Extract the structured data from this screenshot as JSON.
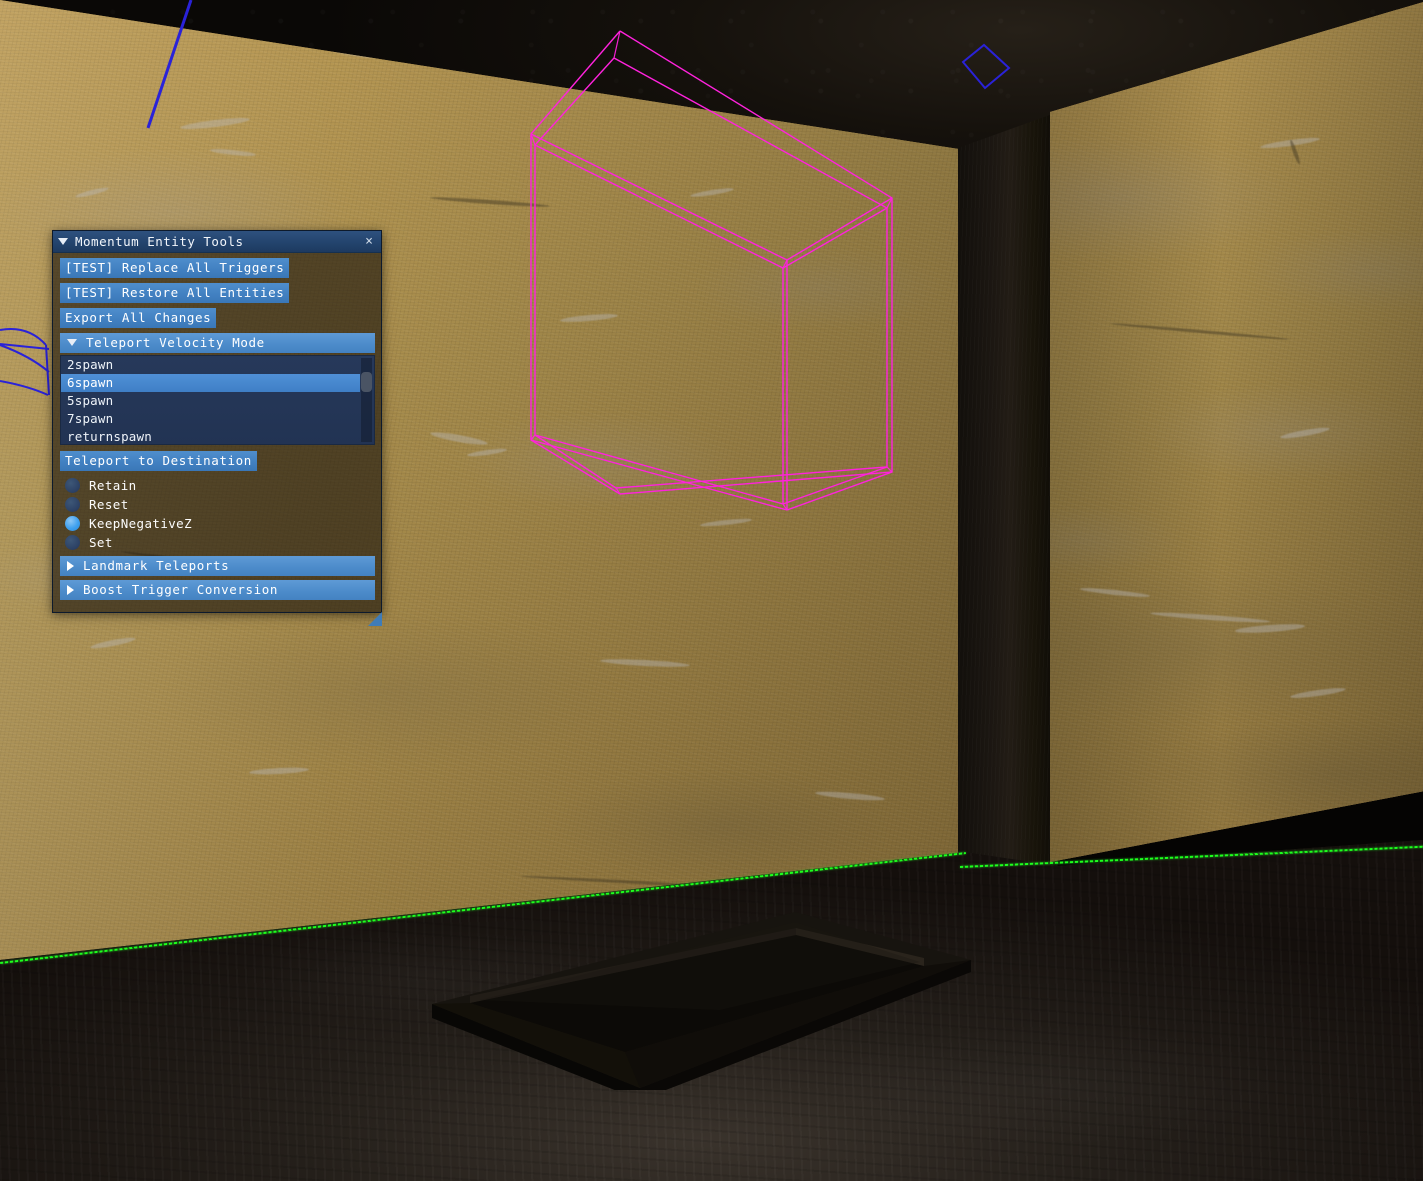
{
  "scene": {
    "name": "source-engine-level-view",
    "description": "3D level viewport with tan plaster walls, dark ceiling, dark floor and a raised rectangular platform",
    "colors": {
      "wall": "#b2924f",
      "floor": "#241f1a",
      "ceiling": "#15110c",
      "brush_outline_green": "#1dff1d",
      "trigger_wireframe_magenta": "#ff22dd",
      "helper_line_blue": "#2a22d8"
    },
    "overlays": [
      {
        "name": "trigger-volume-wireframe",
        "color": "#ff22dd",
        "shape": "box"
      },
      {
        "name": "ceiling-marker-quad",
        "color": "#2a22d8",
        "shape": "quad"
      },
      {
        "name": "helper-line-top-left",
        "color": "#2a22d8",
        "shape": "line"
      },
      {
        "name": "helper-curves-left-edge",
        "color": "#2a22d8",
        "shape": "curves"
      },
      {
        "name": "floor-wall-brush-outline",
        "color": "#1dff1d",
        "shape": "line"
      }
    ]
  },
  "panel": {
    "title": "Momentum Entity Tools",
    "collapse_icon": "triangle-down-icon",
    "close_label": "×",
    "buttons": [
      {
        "id": "replace-all-triggers",
        "label": "[TEST] Replace All Triggers"
      },
      {
        "id": "restore-all-entities",
        "label": "[TEST] Restore All Entities"
      },
      {
        "id": "export-all-changes",
        "label": "Export All Changes"
      }
    ],
    "velocity_section": {
      "title": "Teleport Velocity Mode",
      "expanded": true,
      "icon": "triangle-down-icon"
    },
    "destination_list": {
      "name": "teleport-destination-list",
      "items": [
        {
          "label": "2spawn",
          "selected": false
        },
        {
          "label": "6spawn",
          "selected": true
        },
        {
          "label": "5spawn",
          "selected": false
        },
        {
          "label": "7spawn",
          "selected": false
        },
        {
          "label": "returnspawn",
          "selected": false
        }
      ]
    },
    "teleport_button": {
      "id": "teleport-to-destination",
      "label": "Teleport to Destination"
    },
    "velocity_options": [
      {
        "label": "Retain",
        "selected": false
      },
      {
        "label": "Reset",
        "selected": false
      },
      {
        "label": "KeepNegativeZ",
        "selected": true
      },
      {
        "label": "Set",
        "selected": false
      }
    ],
    "collapsed_sections": [
      {
        "id": "landmark-teleports",
        "label": "Landmark Teleports",
        "icon": "triangle-right-icon"
      },
      {
        "id": "boost-trigger-conversion",
        "label": "Boost Trigger Conversion",
        "icon": "triangle-right-icon"
      }
    ],
    "colors": {
      "titlebar": "#24456f",
      "button": "#4281c2",
      "section_header": "#4d8ccb",
      "list_background": "#223353",
      "list_selected": "#3f7fc6",
      "radio_selected": "#3ea0ef",
      "body": "rgba(26,20,11,0.62)"
    }
  }
}
